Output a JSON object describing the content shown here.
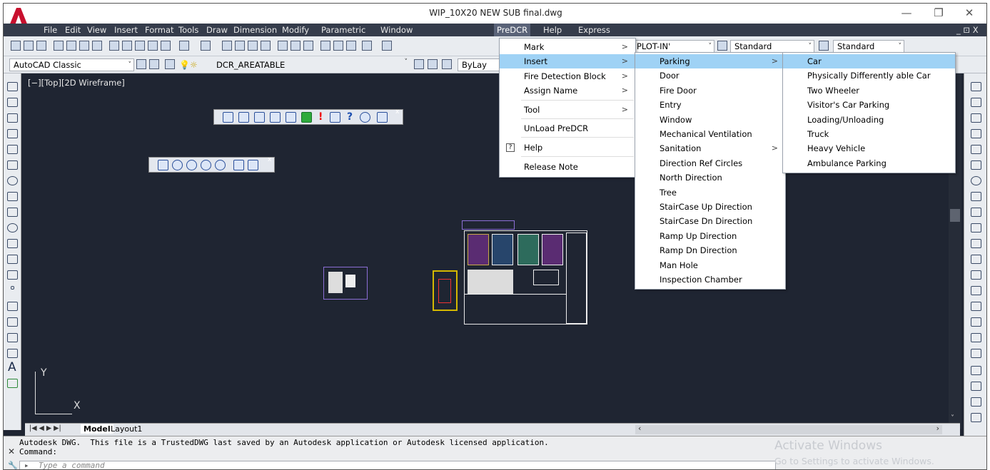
{
  "window": {
    "title": "WIP_10X20 NEW SUB final.dwg",
    "controls": [
      "—",
      "❐",
      "✕"
    ]
  },
  "menubar": [
    "File",
    "Edit",
    "View",
    "Insert",
    "Format",
    "Tools",
    "Draw",
    "Dimension",
    "Modify",
    "Parametric",
    "Window",
    "PreDCR",
    "Help",
    "Express"
  ],
  "menubar_right": "_ ⊡ X",
  "toolbar": {
    "workspace": "AutoCAD Classic",
    "layer": "DCR_AREATABLE",
    "bylayer": "ByLay",
    "plot_combo": "PLOT-IN'",
    "textstyle": "Standard",
    "dimstyle": "Standard"
  },
  "viewport_label": "[−][Top][2D Wireframe]",
  "predcr_menu": [
    {
      "label": "Mark",
      "sub": ">"
    },
    {
      "label": "Insert",
      "sub": ">"
    },
    {
      "label": "Fire Detection Block",
      "sub": ">"
    },
    {
      "label": "Assign Name",
      "sub": ">"
    },
    {
      "label": "Tool",
      "sub": ">"
    },
    {
      "label": "UnLoad PreDCR",
      "sub": ""
    },
    {
      "label": "Help",
      "sub": "",
      "icon": "?"
    },
    {
      "label": "Release Note",
      "sub": ""
    }
  ],
  "insert_menu": [
    {
      "label": "Parking",
      "sub": ">"
    },
    {
      "label": "Door",
      "sub": ""
    },
    {
      "label": "Fire Door",
      "sub": ""
    },
    {
      "label": "Entry",
      "sub": ""
    },
    {
      "label": "Window",
      "sub": ""
    },
    {
      "label": "Mechanical Ventilation",
      "sub": ""
    },
    {
      "label": "Sanitation",
      "sub": ">"
    },
    {
      "label": "Direction Ref Circles",
      "sub": ""
    },
    {
      "label": "North Direction",
      "sub": ""
    },
    {
      "label": "Tree",
      "sub": ""
    },
    {
      "label": "StairCase Up Direction",
      "sub": ""
    },
    {
      "label": "StairCase Dn Direction",
      "sub": ""
    },
    {
      "label": "Ramp Up Direction",
      "sub": ""
    },
    {
      "label": "Ramp Dn Direction",
      "sub": ""
    },
    {
      "label": "Man Hole",
      "sub": ""
    },
    {
      "label": "Inspection Chamber",
      "sub": ""
    }
  ],
  "parking_menu": [
    {
      "label": "Car"
    },
    {
      "label": "Physically Differently able Car"
    },
    {
      "label": "Two Wheeler"
    },
    {
      "label": "Visitor's Car Parking"
    },
    {
      "label": "Loading/Unloading"
    },
    {
      "label": "Truck"
    },
    {
      "label": "Heavy Vehicle"
    },
    {
      "label": "Ambulance Parking"
    }
  ],
  "tabs": {
    "nav": "|◀ ◀ ▶ ▶|",
    "model": "Model",
    "layout1": "Layout1"
  },
  "ucs": {
    "y": "Y",
    "x": "X"
  },
  "command": {
    "line1": "Autodesk DWG.  This file is a TrustedDWG last saved by an Autodesk application or Autodesk licensed application.",
    "line2": "Command:",
    "placeholder": "Type a command",
    "prompt_icon": "▸_"
  },
  "watermark": {
    "line1": "Activate Windows",
    "line2": "Go to Settings to activate Windows."
  },
  "colors": {
    "canvas": "#1f2532",
    "highlight": "#9fd2f5",
    "menubar": "#353c4b"
  }
}
